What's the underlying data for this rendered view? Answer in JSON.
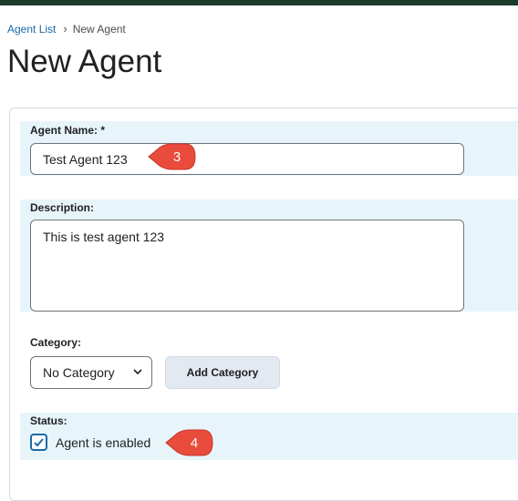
{
  "breadcrumb": {
    "parent": "Agent List",
    "separator": "›",
    "current": "New Agent"
  },
  "page_title": "New Agent",
  "form": {
    "agent_name_label": "Agent Name: *",
    "agent_name_value": "Test Agent 123",
    "description_label": "Description:",
    "description_value": "This is test agent 123",
    "category_label": "Category:",
    "category_selected": "No Category",
    "add_category_label": "Add Category",
    "status_label": "Status:",
    "status_checkbox_label": "Agent is enabled",
    "status_enabled": true
  },
  "callouts": {
    "name_step": "3",
    "status_step": "4"
  },
  "colors": {
    "accent": "#1a6aa8",
    "callout": "#e94b3c",
    "band": "#e7f5fb",
    "topbar": "#1d3b2a"
  }
}
